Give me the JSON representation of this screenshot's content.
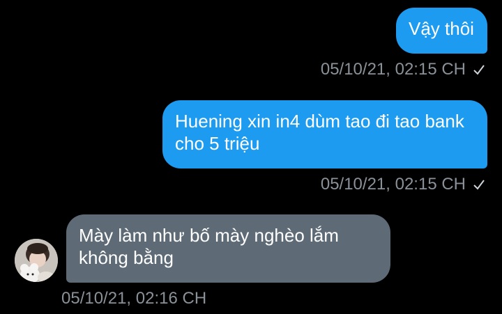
{
  "messages": [
    {
      "text": "Vậy thôi",
      "timestamp": "05/10/21, 02:15 CH",
      "direction": "sent",
      "read_icon": "check-icon"
    },
    {
      "text": "Huening xin in4 dùm tao đi tao bank\ncho 5 triệu",
      "timestamp": "05/10/21, 02:15 CH",
      "direction": "sent",
      "read_icon": "check-icon"
    },
    {
      "text": "Mày làm như bố mày nghèo lắm\nkhông bằng",
      "timestamp": "05/10/21, 02:16 CH",
      "direction": "received",
      "avatar": "user-avatar"
    }
  ],
  "colors": {
    "background": "#000000",
    "sent_bubble": "#1d9bf0",
    "received_bubble": "#5e6b77",
    "timestamp": "#8a9199"
  }
}
